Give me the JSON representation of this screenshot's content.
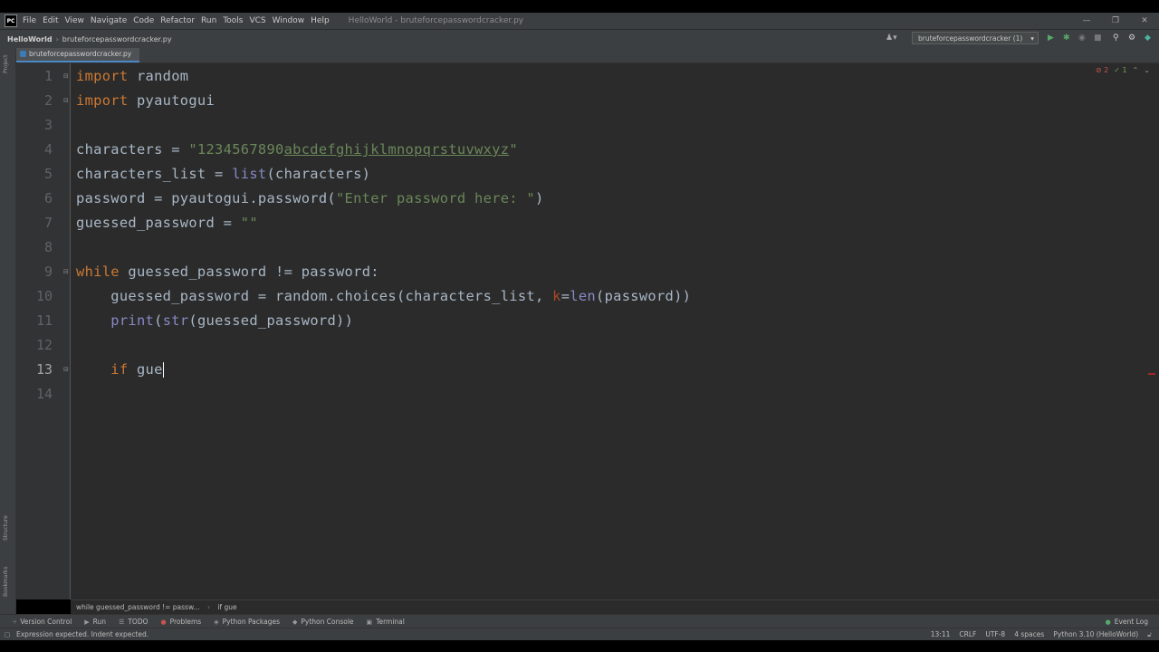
{
  "menu": {
    "items": [
      "File",
      "Edit",
      "View",
      "Navigate",
      "Code",
      "Refactor",
      "Run",
      "Tools",
      "VCS",
      "Window",
      "Help"
    ],
    "window_title": "HelloWorld - bruteforcepasswordcracker.py",
    "logo": "PC",
    "minimize": "—",
    "maximize": "❐",
    "close": "✕"
  },
  "nav": {
    "project": "HelloWorld",
    "file": "bruteforcepasswordcracker.py",
    "run_config": "bruteforcepasswordcracker (1)"
  },
  "tab": {
    "label": "bruteforcepasswordcracker.py"
  },
  "side": {
    "project": "Project",
    "structure": "Structure",
    "bookmarks": "Bookmarks"
  },
  "inspections": {
    "errors": "2",
    "ok": "1"
  },
  "editor": {
    "line_numbers": [
      "1",
      "2",
      "3",
      "4",
      "5",
      "6",
      "7",
      "8",
      "9",
      "10",
      "11",
      "12",
      "13",
      "14"
    ],
    "l1_kw": "import",
    "l1_rest": " random",
    "l2_kw": "import",
    "l2_rest": " pyautogui",
    "l4_a": "characters = ",
    "l4_s1": "\"1234567890",
    "l4_s2": "abcdefghijklmnopqrstuvwxyz",
    "l4_s3": "\"",
    "l5_a": "characters_list = ",
    "l5_bi": "list",
    "l5_b": "(characters)",
    "l6_a": "password = pyautogui.password(",
    "l6_s": "\"Enter password here: \"",
    "l6_b": ")",
    "l7_a": "guessed_password = ",
    "l7_s": "\"\"",
    "l9_kw": "while",
    "l9_rest": " guessed_password != password:",
    "l10_a": "    guessed_password = random.choices(characters_list, ",
    "l10_p": "k",
    "l10_b": "=",
    "l10_bi": "len",
    "l10_c": "(password))",
    "l11_ind": "    ",
    "l11_bi": "print",
    "l11_a": "(",
    "l11_bi2": "str",
    "l11_b": "(guessed_password))",
    "l13_ind": "    ",
    "l13_kw": "if",
    "l13_rest": " gue"
  },
  "breadcrumbs": [
    "while guessed_password != passw...",
    "if gue"
  ],
  "tool_windows": [
    "Version Control",
    "Run",
    "TODO",
    "Problems",
    "Python Packages",
    "Python Console",
    "Terminal"
  ],
  "event_log": "Event Log",
  "status": {
    "message": "Expression expected. Indent expected.",
    "position": "13:11",
    "line_sep": "CRLF",
    "encoding": "UTF-8",
    "indent": "4 spaces",
    "interpreter": "Python 3.10 (HelloWorld)"
  }
}
